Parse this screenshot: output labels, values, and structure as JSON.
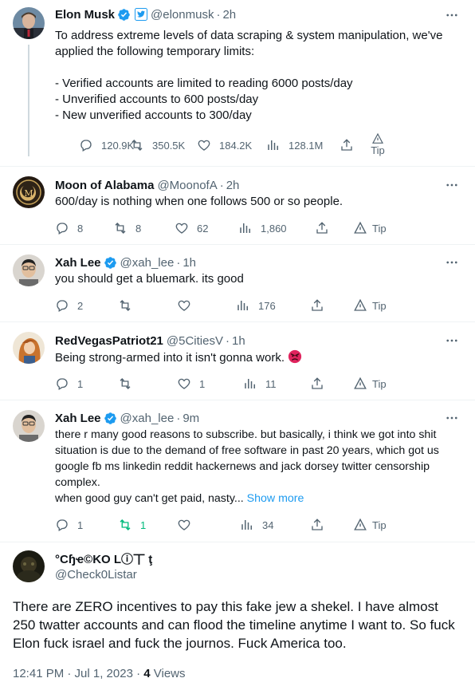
{
  "tweets": [
    {
      "name": "Elon Musk",
      "handle": "@elonmusk",
      "time": "2h",
      "text": "To address extreme levels of data scraping & system manipulation, we've applied the following temporary limits:\n\n- Verified accounts are limited to reading 6000 posts/day\n- Unverified accounts to 600 posts/day\n- New unverified accounts to 300/day",
      "replies": "120.9K",
      "retweets": "350.5K",
      "likes": "184.2K",
      "views": "128.1M",
      "tip": "Tip"
    },
    {
      "name": "Moon of Alabama",
      "handle": "@MoonofA",
      "time": "2h",
      "text": "600/day is nothing when one follows 500 or so people.",
      "replies": "8",
      "retweets": "8",
      "likes": "62",
      "views": "1,860",
      "tip": "Tip"
    },
    {
      "name": "Xah Lee",
      "handle": "@xah_lee",
      "time": "1h",
      "text": "you should get a bluemark. its good",
      "replies": "2",
      "retweets": "",
      "likes": "",
      "views": "176",
      "tip": "Tip"
    },
    {
      "name": "RedVegasPatriot21",
      "handle": "@5CitiesV",
      "time": "1h",
      "text": "Being strong-armed into it isn't gonna work.",
      "replies": "1",
      "retweets": "",
      "likes": "1",
      "views": "11",
      "tip": "Tip"
    },
    {
      "name": "Xah Lee",
      "handle": "@xah_lee",
      "time": "9m",
      "text": "there r many good reasons to subscribe. but basically, i think we got into shit situation is due to the demand of free software in past 20 years, which got us google fb ms linkedin reddit hackernews and jack dorsey twitter censorship complex.\nwhen good guy can't get paid, nasty...",
      "show_more": "Show more",
      "replies": "1",
      "retweets": "1",
      "likes": "",
      "views": "34",
      "tip": "Tip"
    }
  ],
  "main": {
    "name": "°Cɧҽ©KO Lⓘ丅 ţ",
    "handle": "@Check0Listar",
    "text": "There are ZERO incentives to pay this fake jew a shekel. I have almost 250 twatter accounts and can flood the timeline anytime I want to. So fuck Elon fuck israel and fuck the journos. Fuck America too.",
    "timestamp": "12:41 PM · Jul 1, 2023 · ",
    "views_count": "4",
    "views_label": " Views"
  },
  "icons": {
    "verified": "verified-badge-icon",
    "more": "more-dots-icon",
    "reply": "reply-icon",
    "retweet": "retweet-icon",
    "like": "heart-icon",
    "views": "views-icon",
    "share": "share-icon",
    "tip": "tip-icon",
    "angry": "angry-emoji-icon"
  },
  "colors": {
    "accent": "#1d9bf0",
    "retweet_active": "#00ba7c",
    "muted": "#536471",
    "divider": "#eff3f4",
    "thread_line": "#cfd9de"
  }
}
